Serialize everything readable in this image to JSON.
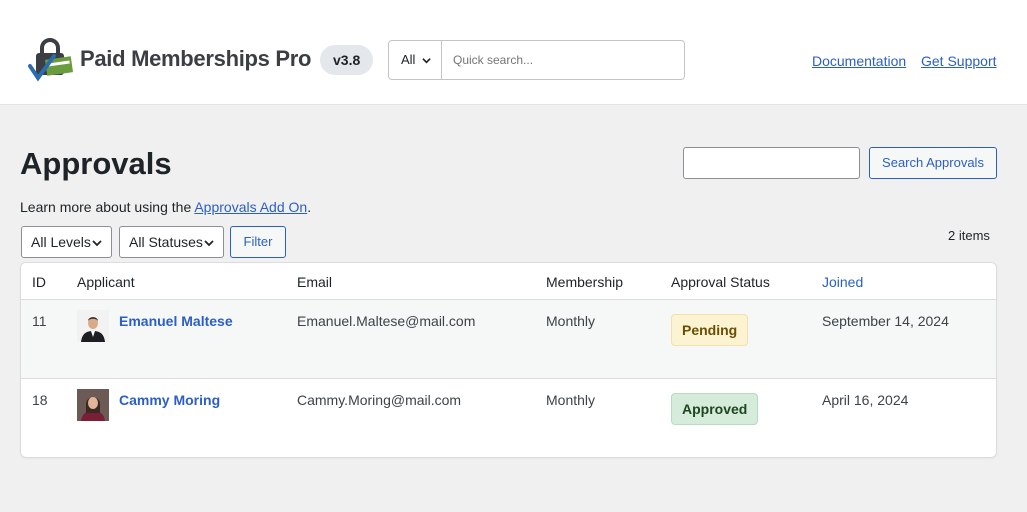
{
  "header": {
    "brand": "Paid Memberships Pro",
    "version": "v3.8",
    "search_scope": "All",
    "search_placeholder": "Quick search...",
    "links": [
      "Documentation",
      "Get Support"
    ]
  },
  "page": {
    "title": "Approvals",
    "search_button": "Search Approvals",
    "learn_prefix": "Learn more about using the ",
    "learn_link": "Approvals Add On",
    "learn_suffix": ".",
    "filters": {
      "levels": "All Levels",
      "statuses": "All Statuses",
      "filter_button": "Filter"
    },
    "items_count": "2 items"
  },
  "table": {
    "columns": [
      "ID",
      "Applicant",
      "Email",
      "Membership",
      "Approval Status",
      "Joined"
    ],
    "rows": [
      {
        "id": "11",
        "name": "Emanuel Maltese",
        "email": "Emanuel.Maltese@mail.com",
        "membership": "Monthly",
        "status": "Pending",
        "joined": "September 14, 2024"
      },
      {
        "id": "18",
        "name": "Cammy Moring",
        "email": "Cammy.Moring@mail.com",
        "membership": "Monthly",
        "status": "Approved",
        "joined": "April 16, 2024"
      }
    ]
  },
  "colors": {
    "accent": "#2b5fc7",
    "pending_bg": "#fcf3d3",
    "pending_border": "#f0e2a8",
    "pending_text": "#6b4e00",
    "approved_bg": "#d4ecd9",
    "approved_border": "#b9dcc0",
    "approved_text": "#1e4620"
  },
  "icons": {
    "logo": "padlock-check-icon",
    "chevron": "chevron-down-icon"
  }
}
